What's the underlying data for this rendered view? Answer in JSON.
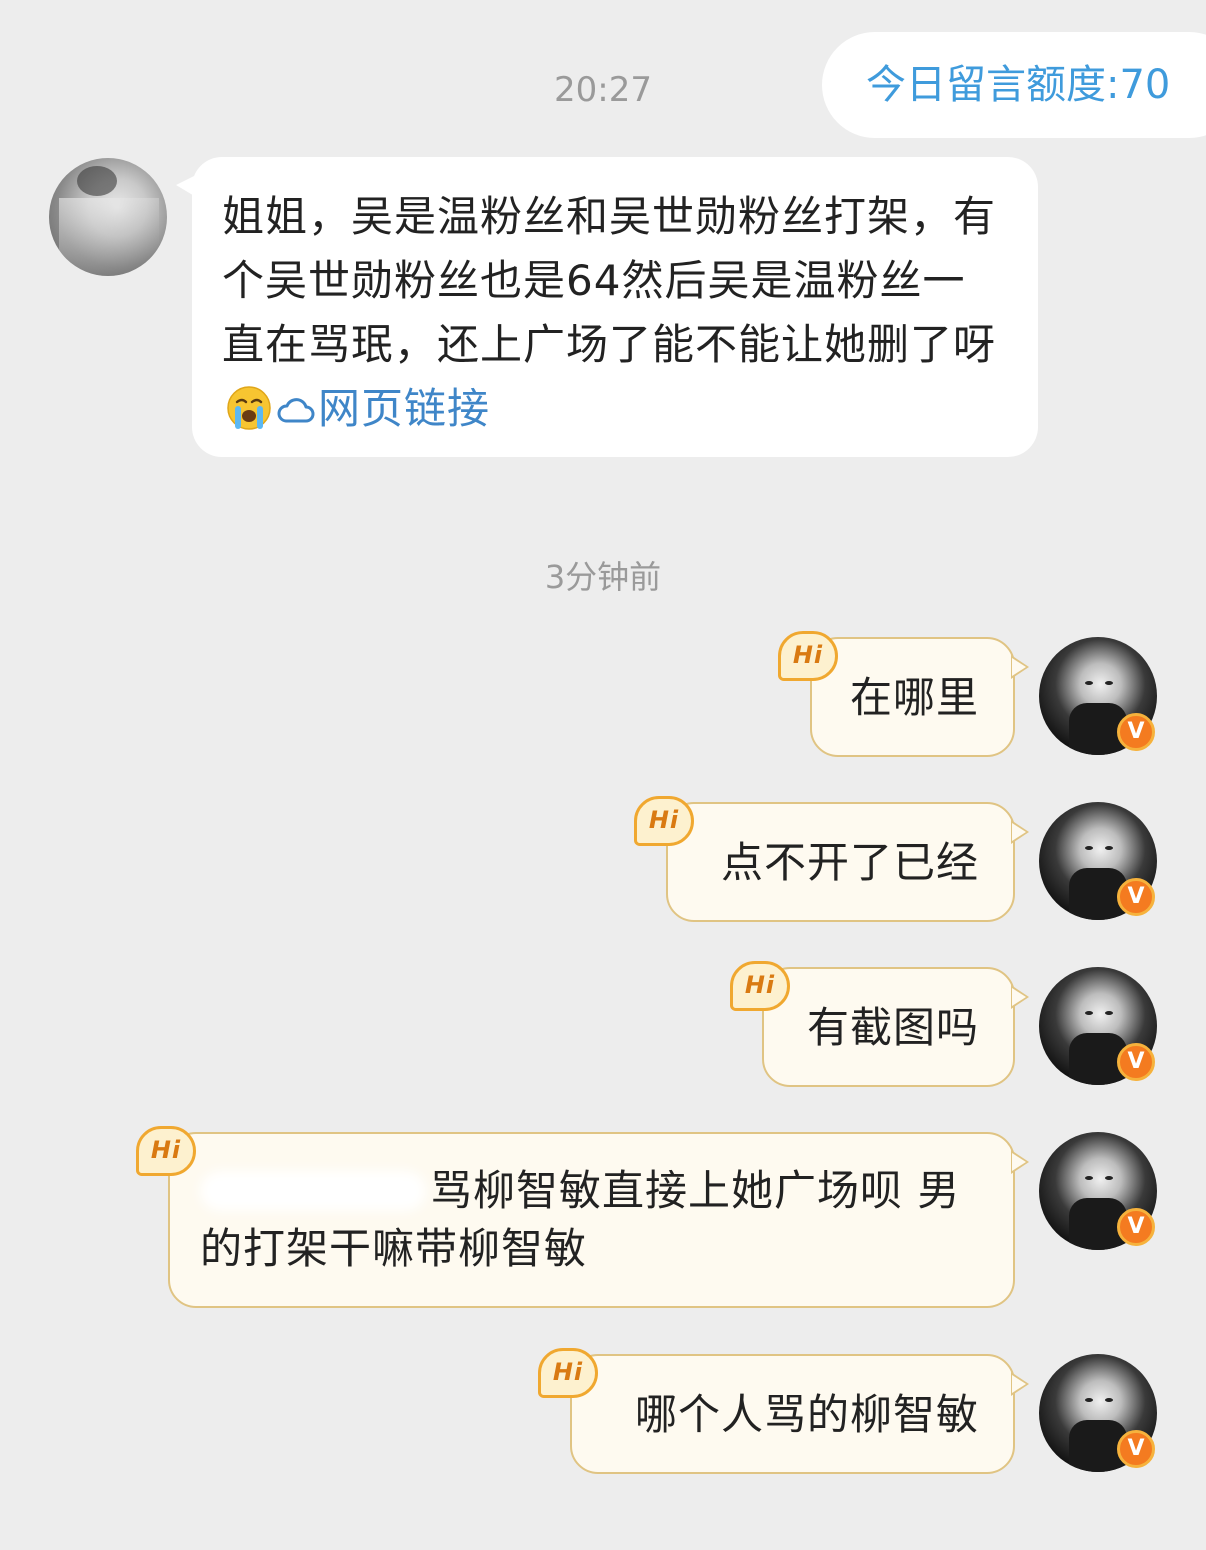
{
  "header": {
    "quota_text": "今日留言额度:70"
  },
  "timestamps": {
    "first": "20:27",
    "second": "3分钟前"
  },
  "incoming": {
    "text": "姐姐，吴是温粉丝和吴世勋粉丝打架，有个吴世勋粉丝也是64然后吴是温粉丝一直在骂珉，还上广场了能不能让她删了呀",
    "emoji": "crying-face",
    "link_label": "网页链接",
    "link_icon": "cloud-icon"
  },
  "outgoing": [
    {
      "badge": "Hi",
      "text": "在哪里"
    },
    {
      "badge": "Hi",
      "text": "点不开了已经"
    },
    {
      "badge": "Hi",
      "text": "有截图吗"
    },
    {
      "badge": "Hi",
      "text": "骂柳智敏直接上她广场呗 男的打架干嘛带柳智敏",
      "redacted_prefix": true
    },
    {
      "badge": "Hi",
      "text": "哪个人骂的柳智敏"
    }
  ],
  "colors": {
    "background": "#ededed",
    "quota_text": "#3f9bdc",
    "link": "#3f86c8",
    "outgoing_bubble_fill": "#fefaf0",
    "outgoing_bubble_border": "#e0c483",
    "hi_badge": "#f0a830",
    "verified_badge": "#f47b20"
  },
  "avatar_badge": "V"
}
